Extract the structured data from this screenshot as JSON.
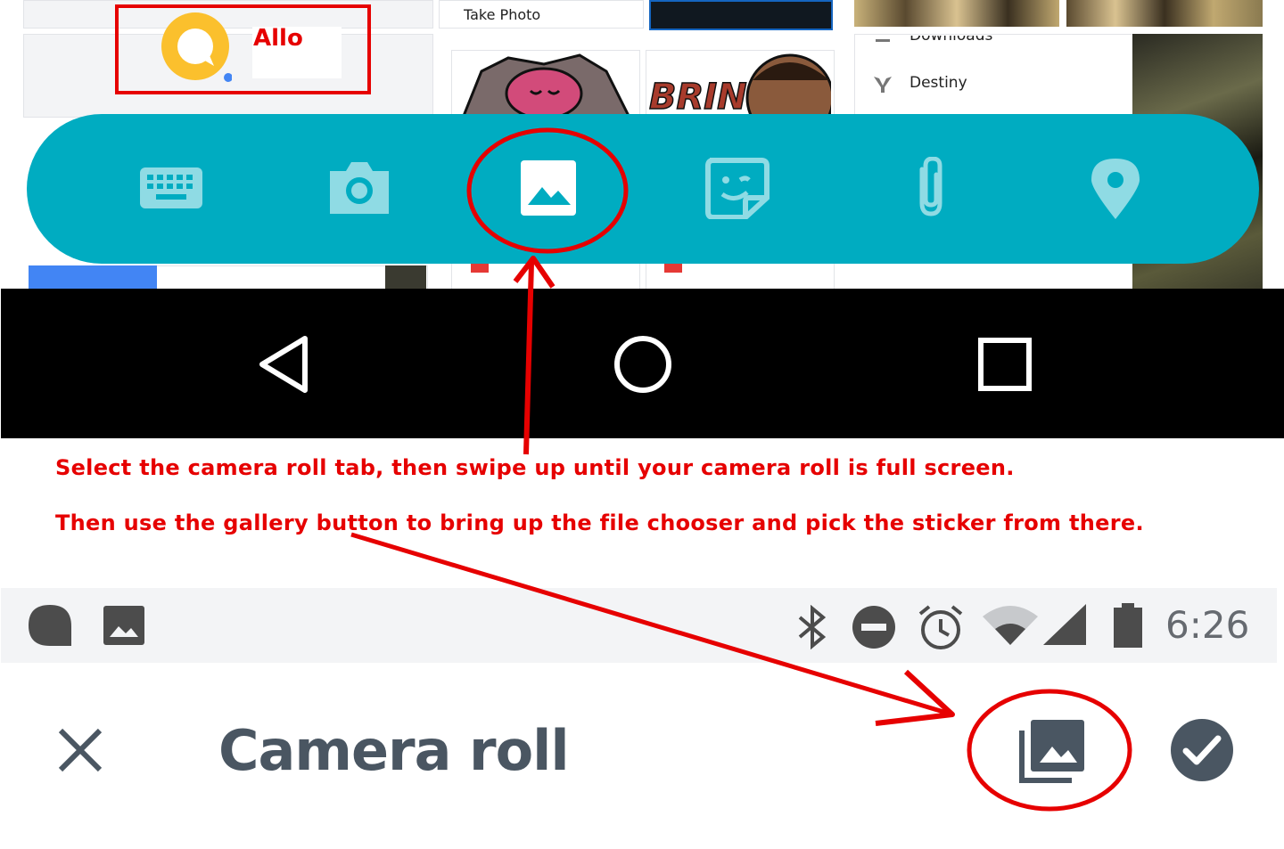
{
  "background": {
    "allo_label": "Allo",
    "menu_take_photo": "Take Photo",
    "menu_downloads": "Downloads",
    "menu_destiny": "Destiny",
    "sticker_text": "BRING"
  },
  "toolbar": {
    "icons": [
      "keyboard-icon",
      "camera-icon",
      "image-icon",
      "sticker-icon",
      "attachment-icon",
      "location-icon"
    ],
    "color": "#00acc1"
  },
  "navbar": {
    "buttons": [
      "back-button",
      "home-button",
      "recents-button"
    ]
  },
  "instructions": {
    "line1": "Select the camera roll tab, then swipe up until your camera roll is full screen.",
    "line2": "Then use the gallery button to bring up the file chooser and pick the sticker from there."
  },
  "statusbar": {
    "time": "6:26",
    "icons": [
      "allo-notification-icon",
      "gallery-notification-icon",
      "bluetooth-icon",
      "do-not-disturb-icon",
      "alarm-icon",
      "wifi-icon",
      "cell-signal-icon",
      "battery-icon"
    ]
  },
  "appbar": {
    "title": "Camera roll"
  },
  "colors": {
    "annotation_red": "#e60000",
    "toolbar": "#00acc1",
    "appbar_text": "#4a5662"
  }
}
